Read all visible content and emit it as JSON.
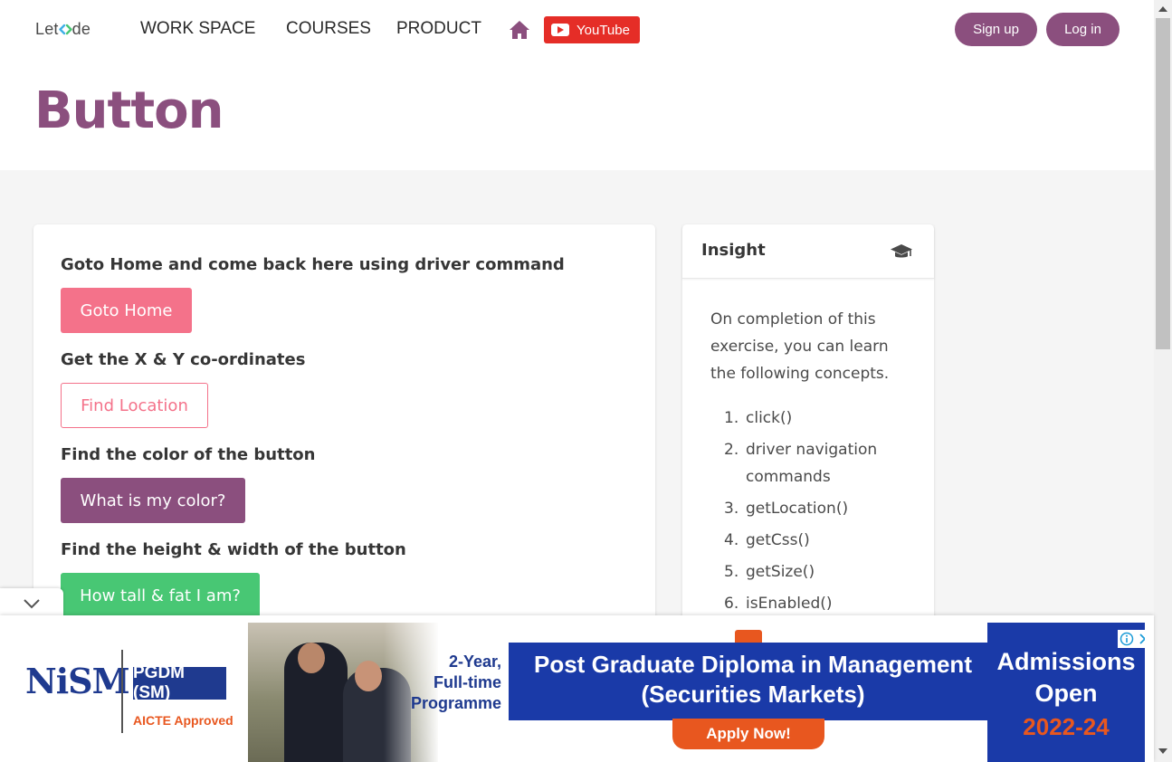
{
  "navbar": {
    "logo": {
      "pre": "Let",
      "post": "de"
    },
    "items": [
      {
        "label": "WORK SPACE"
      },
      {
        "label": "COURSES"
      },
      {
        "label": "PRODUCT"
      }
    ],
    "youtube_label": "YouTube",
    "signup_label": "Sign up",
    "login_label": "Log in",
    "brand_color": "#8b4f7e"
  },
  "page": {
    "title": "Button"
  },
  "exercises": [
    {
      "question": "Goto Home and come back here using driver command",
      "button": "Goto Home",
      "color": "#f4728a"
    },
    {
      "question": "Get the X & Y co-ordinates",
      "button": "Find Location",
      "color": "#f4728a"
    },
    {
      "question": "Find the color of the button",
      "button": "What is my color?",
      "color": "#8b4f7e"
    },
    {
      "question": "Find the height & width of the button",
      "button": "How tall & fat I am?",
      "color": "#48c774"
    }
  ],
  "insight": {
    "title": "Insight",
    "icon": "graduation-cap-icon",
    "description": "On completion of this exercise, you can learn the following concepts.",
    "concepts": [
      {
        "num": "1.",
        "text": "click()"
      },
      {
        "num": "2.",
        "text": "driver navigation commands"
      },
      {
        "num": "3.",
        "text": "getLocation()"
      },
      {
        "num": "4.",
        "text": "getCss()"
      },
      {
        "num": "5.",
        "text": "getSize()"
      },
      {
        "num": "6.",
        "text": "isEnabled()"
      }
    ]
  },
  "ad": {
    "logo": "NiSM",
    "badge": "PGDM (SM)",
    "approval": "AICTE Approved",
    "programme": [
      "2-Year,",
      "Full-time",
      "Programme"
    ],
    "headline": [
      "Post Graduate Diploma in Management",
      "(Securities Markets)"
    ],
    "cta": "Apply Now!",
    "admissions": [
      "Admissions",
      "Open"
    ],
    "year": "2022-24"
  }
}
